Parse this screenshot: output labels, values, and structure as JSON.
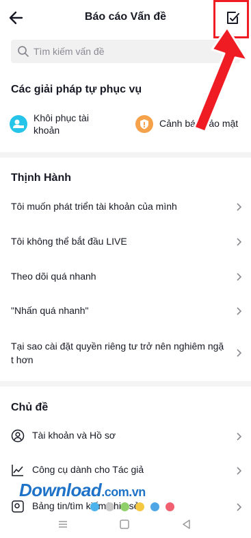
{
  "header": {
    "title": "Báo cáo Vấn đề"
  },
  "search": {
    "placeholder": "Tìm kiếm vấn đề"
  },
  "self_service": {
    "title": "Các giải pháp tự phục vụ",
    "items": [
      {
        "label_line1": "Khôi phục tài",
        "label_line2": "khoản",
        "icon": "account-recovery-icon",
        "color": "#25c4e8"
      },
      {
        "label": "Cảnh báo bảo mật",
        "icon": "security-shield-icon",
        "color": "#f5a24a"
      }
    ]
  },
  "trending": {
    "title": "Thịnh Hành",
    "items": [
      {
        "label": "Tôi muốn phát triển tài khoản của mình"
      },
      {
        "label": "Tôi không thể bắt đầu LIVE"
      },
      {
        "label": "Theo dõi quá nhanh"
      },
      {
        "label": "\"Nhấn quá nhanh\""
      },
      {
        "label_line1": "Tại sao cài đặt quyền riêng tư trở nên nghiêm ngặ",
        "label_line2": "t hơn"
      }
    ]
  },
  "topics": {
    "title": "Chủ đề",
    "items": [
      {
        "label": "Tài khoản và Hồ sơ",
        "icon": "user-icon"
      },
      {
        "label": "Công cụ dành cho Tác giả",
        "icon": "chart-line-icon"
      },
      {
        "label": "Bảng tin/tìm kiếm/chia sẻ",
        "icon": "search-feed-icon"
      }
    ]
  },
  "watermark": {
    "text": "Download",
    "suffix": ".com.vn"
  },
  "colors": {
    "accent_red": "#f01c24",
    "watermark_blue": "#1e73c8"
  }
}
